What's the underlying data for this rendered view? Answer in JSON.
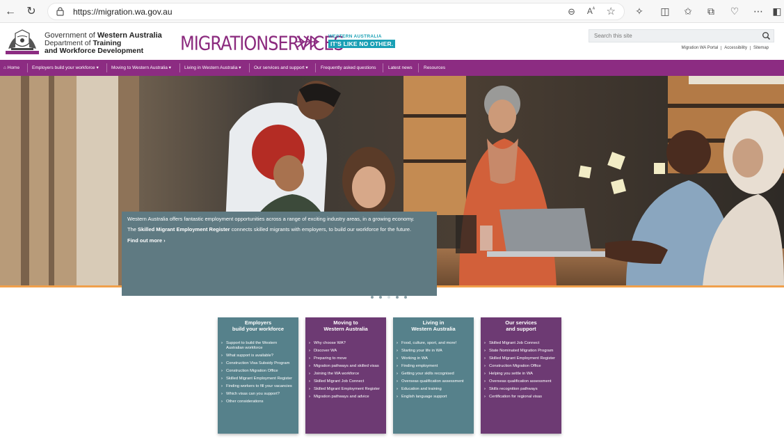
{
  "browser": {
    "url": "https://migration.wa.gov.au"
  },
  "header": {
    "govt_line1_prefix": "Government of ",
    "govt_line1_bold": "Western Australia",
    "govt_line2_prefix": "Department of ",
    "govt_line2_bold": "Training",
    "govt_line3": "and Workforce Development",
    "logo_migration": "MIGRATION",
    "logo_services": "SERVICES",
    "tagline_top": "WESTERN AUSTRALIA",
    "tagline_bottom": "IT'S LIKE NO OTHER.",
    "search_placeholder": "Search this site",
    "util_links": [
      "Migration WA Portal",
      "Accessibility",
      "Sitemap"
    ]
  },
  "nav": {
    "home": "Home",
    "items": [
      "Employers build your workforce ▾",
      "Moving to Western Australia ▾",
      "Living in Western Australia ▾",
      "Our services and support ▾",
      "Frequently asked questions",
      "Latest news",
      "Resources"
    ]
  },
  "hero": {
    "intro": "Western Australia offers fantastic employment opportunities across a range of exciting industry areas, in a growing economy.",
    "register_prefix": "The ",
    "register_bold": "Skilled Migrant Employment Register",
    "register_suffix": " connects skilled migrants with employers, to build our workforce for the future.",
    "cta": "Find out more ›",
    "slide_count": 5,
    "active_slide": 3
  },
  "tiles": [
    {
      "title_l1": "Employers",
      "title_l2": "build your workforce",
      "color": "#56818b",
      "links": [
        "Support to build the Western Australian workforce",
        "What support is available?",
        "Construction Visa Subsidy Program",
        "Construction Migration Office",
        "Skilled Migrant Employment Register",
        "Finding workers to fill your vacancies",
        "Which visas can you support?",
        "Other considerations"
      ]
    },
    {
      "title_l1": "Moving to",
      "title_l2": "Western Australia",
      "color": "#6d3a73",
      "links": [
        "Why choose WA?",
        "Discover WA",
        "Preparing to move",
        "Migration pathways and skilled visas",
        "Joining the WA workforce",
        "Skilled Migrant Job Connect",
        "Skilled Migrant Employment Register",
        "Migration pathways and advice"
      ]
    },
    {
      "title_l1": "Living in",
      "title_l2": "Western Australia",
      "color": "#56818b",
      "links": [
        "Food, culture, sport, and more!",
        "Starting your life in WA",
        "Working in WA",
        "Finding employment",
        "Getting your skills recognised",
        "Overseas qualification assessment",
        "Education and training",
        "English language support"
      ]
    },
    {
      "title_l1": "Our services",
      "title_l2": "and support",
      "color": "#6d3a73",
      "links": [
        "Skilled Migrant Job Connect",
        "State Nominated Migration Program",
        "Skilled Migrant Employment Register",
        "Construction Migration Office",
        "Helping you settle in WA",
        "Overseas qualification assessment",
        "Skills recognition pathways",
        "Certification for regional visas"
      ]
    }
  ]
}
